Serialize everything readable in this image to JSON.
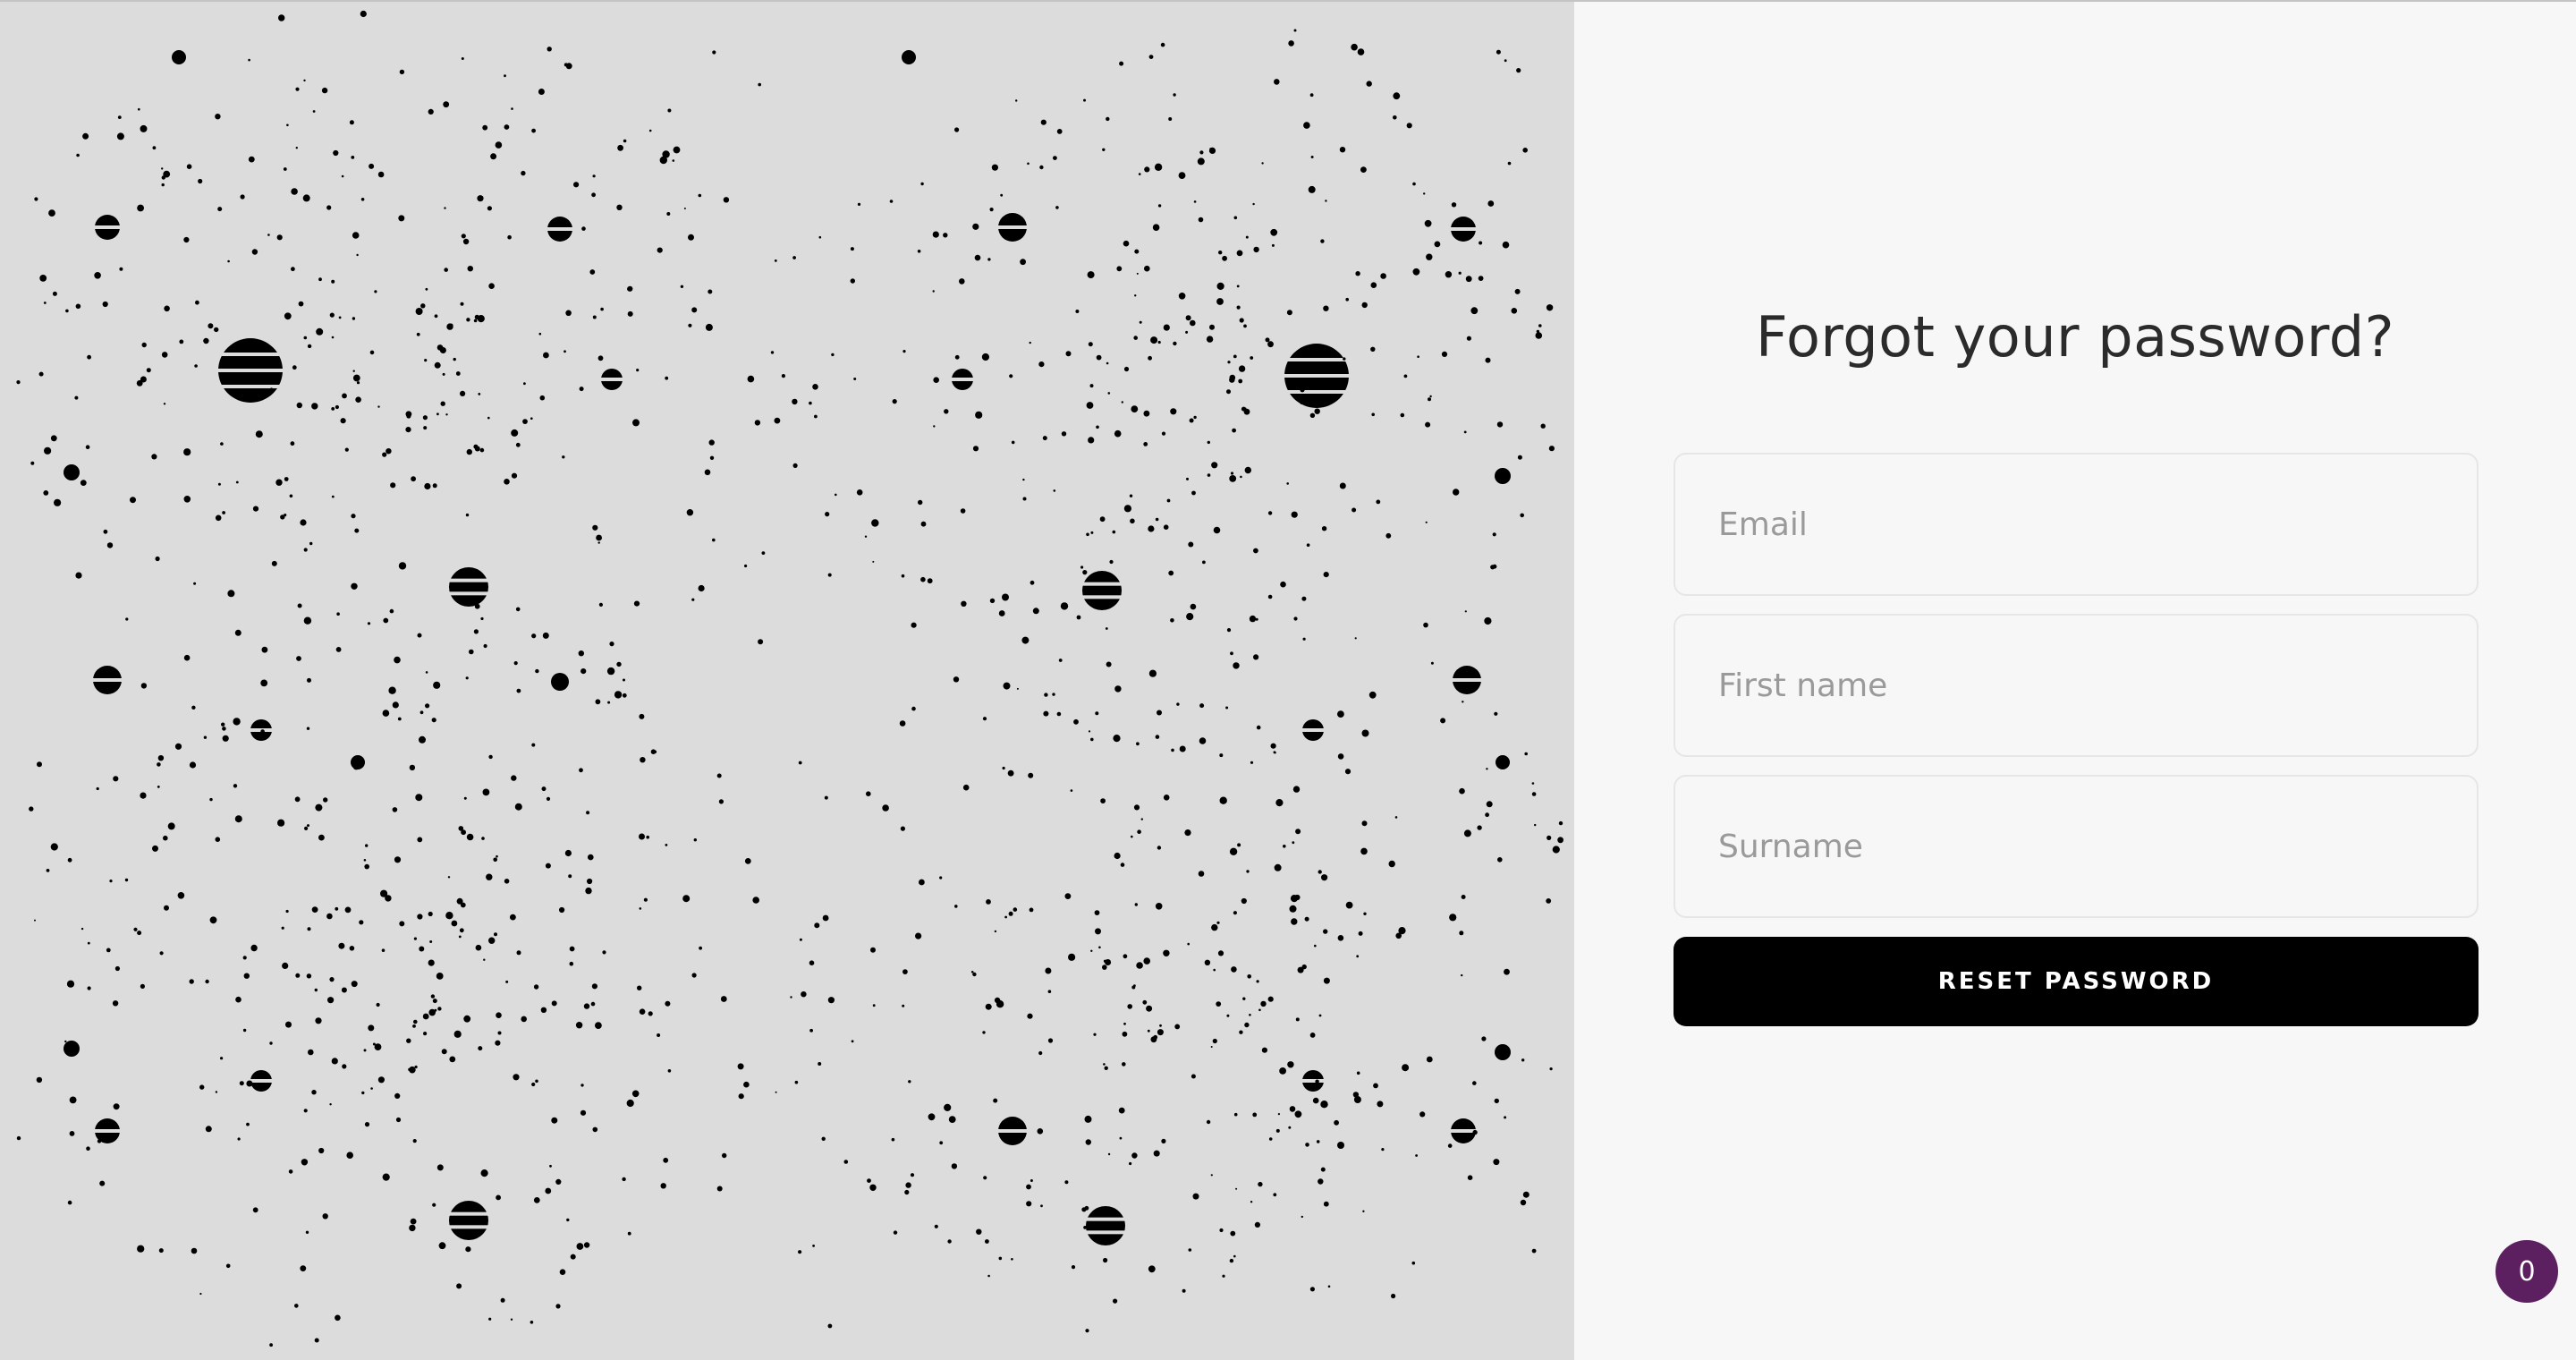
{
  "form": {
    "title": "Forgot your password?",
    "email_placeholder": "Email",
    "first_name_placeholder": "First name",
    "surname_placeholder": "Surname",
    "submit_label": "RESET PASSWORD"
  },
  "badge": {
    "count": "0",
    "color": "#5c1f5f"
  },
  "background_pattern": {
    "color": "#dcdcdc",
    "dot_color": "#000000",
    "icon": "halftone-dot-pattern"
  }
}
